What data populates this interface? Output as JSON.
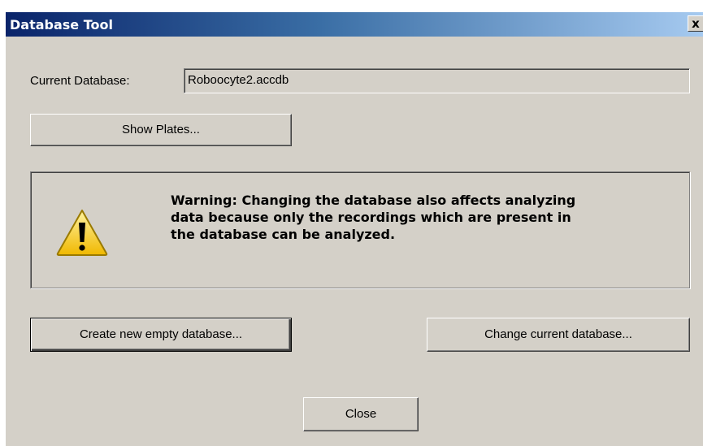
{
  "window": {
    "title": "Database Tool",
    "close_glyph": "x"
  },
  "current_db": {
    "label": "Current Database:",
    "value": "Roboocyte2.accdb"
  },
  "buttons": {
    "show_plates": "Show Plates...",
    "create_new": "Create new empty database...",
    "change_current": "Change current database...",
    "close": "Close"
  },
  "warning": {
    "icon": "warning-triangle-icon",
    "line1": "Warning: Changing the database also affects analyzing",
    "line2": "data because only the recordings which are present in",
    "line3": "the database can be analyzed."
  },
  "colors": {
    "face": "#d4d0c8",
    "title_start": "#0a246a",
    "title_end": "#a6caf0",
    "warning_yellow": "#f5c400"
  }
}
